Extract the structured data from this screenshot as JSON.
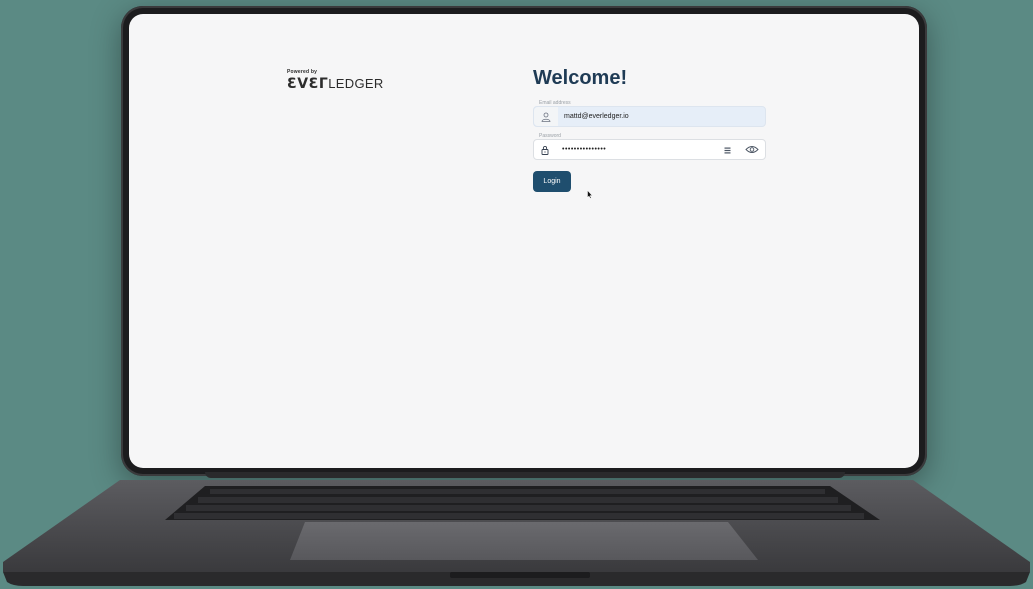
{
  "logo": {
    "powered_by": "Powered by",
    "brand_ever": "ƐVƐΓ",
    "brand_ledger": "LEDGER"
  },
  "form": {
    "title": "Welcome!",
    "email": {
      "label": "Email address",
      "value": "mattd@everledger.io",
      "icon": "user-icon"
    },
    "password": {
      "label": "Password",
      "value": "•••••••••••••••",
      "icon": "lock-icon",
      "manager_icon": "password-manager-icon",
      "toggle_icon": "eye-icon"
    },
    "login_label": "Login"
  },
  "colors": {
    "background": "#5b8a84",
    "title": "#1f3b55",
    "button": "#1f4e6e",
    "email_autofill": "#e6eef8"
  }
}
